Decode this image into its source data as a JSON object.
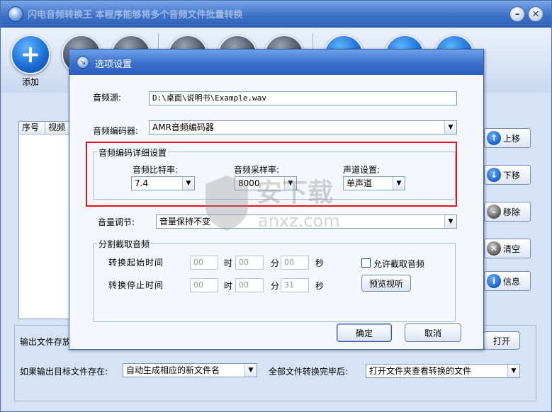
{
  "main": {
    "title": "闪电音频转换王  本程序能够将多个音频文件批量转换",
    "toolbar": {
      "add_label": "添加"
    },
    "file_table": {
      "columns": [
        "序号",
        "视频"
      ]
    },
    "side_buttons": {
      "up": "上移",
      "down": "下移",
      "remove": "移除",
      "clear": "清空",
      "info": "信息"
    },
    "output": {
      "folder_label": "输出文件存放",
      "open_button": "打开",
      "if_exists_label": "如果输出目标文件存在:",
      "if_exists_value": "自动生成相应的新文件名",
      "after_label": "全部文件转换完毕后:",
      "after_value": "打开文件夹查看转换的文件"
    }
  },
  "dialog": {
    "title": "选项设置",
    "source_label": "音频源:",
    "source_value": "D:\\桌面\\说明书\\Example.wav",
    "encoder_label": "音频编码器:",
    "encoder_value": "AMR音频编码器",
    "detail_group": "音频编码详细设置",
    "bitrate_label": "音频比特率:",
    "bitrate_value": "7.4",
    "samplerate_label": "音频采样率:",
    "samplerate_value": "8000",
    "channel_label": "声道设置:",
    "channel_value": "单声道",
    "volume_label": "音量调节:",
    "volume_value": "音量保持不变",
    "split_group": "分割截取音频",
    "start_label": "转换起始时间",
    "stop_label": "转换停止时间",
    "hour_unit": "时",
    "minute_unit": "分",
    "second_unit": "秒",
    "start_h": "00",
    "start_m": "00",
    "start_s": "00",
    "stop_h": "00",
    "stop_m": "00",
    "stop_s": "31",
    "allow_split_label": "允许截取音频",
    "allow_split_checked": false,
    "preview_button": "预览视听",
    "ok_button": "确定",
    "cancel_button": "取消"
  },
  "watermark": {
    "text": "安下载",
    "sub": "anxz.com"
  },
  "colors": {
    "highlight_border": "#e0141b",
    "title_blue": "#3a70cc"
  }
}
